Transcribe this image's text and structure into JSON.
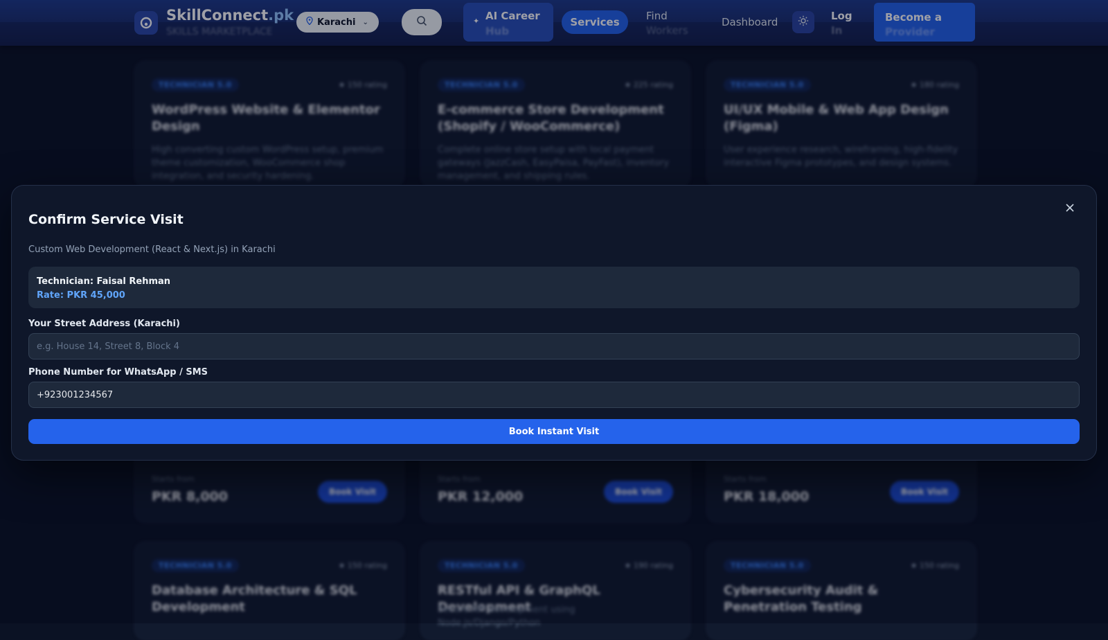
{
  "nav": {
    "brand": {
      "name": "SkillConnect",
      "tld": ".pk",
      "tagline": "SKILLS MARKETPLACE"
    },
    "city": "Karachi",
    "ai_career": {
      "line1": "AI Career",
      "line2": "Hub"
    },
    "services": "Services",
    "find_workers": {
      "line1": "Find",
      "line2": "Workers"
    },
    "dashboard": "Dashboard",
    "login": {
      "line1": "Log",
      "line2": "In"
    },
    "become_provider": {
      "line1": "Become a",
      "line2": "Provider"
    }
  },
  "cards": [
    {
      "badge": "TECHNICIAN 5.0",
      "rating": "★ 150 rating",
      "title": "WordPress Website & Elementor Design",
      "desc": "High converting custom WordPress setup, premium theme customization, WooCommerce shop integration, and security hardening."
    },
    {
      "badge": "TECHNICIAN 5.0",
      "rating": "★ 225 rating",
      "title": "E-commerce Store Development (Shopify / WooCommerce)",
      "desc": "Complete online store setup with local payment gateways (JazzCash, EasyPaisa, PayFast), inventory management, and shipping rules."
    },
    {
      "badge": "TECHNICIAN 5.0",
      "rating": "★ 180 rating",
      "title": "UI/UX Mobile & Web App Design (Figma)",
      "desc": "User experience research, wireframing, high-fidelity interactive Figma prototypes, and design systems."
    },
    {
      "slabel": "Starts from",
      "price": "PKR 8,000",
      "book": "Book Visit"
    },
    {
      "slabel": "Starts from",
      "price": "PKR 12,000",
      "book": "Book Visit"
    },
    {
      "slabel": "Starts from",
      "price": "PKR 18,000",
      "book": "Book Visit"
    },
    {
      "badge": "TECHNICIAN 5.0",
      "rating": "★ 150 rating",
      "title": "Database Architecture & SQL Development"
    },
    {
      "badge": "TECHNICIAN 5.0",
      "rating": "★ 190 rating",
      "title": "RESTful API & GraphQL Development",
      "desc": "Secure API development using Node.js/Django/Python"
    },
    {
      "badge": "TECHNICIAN 5.0",
      "rating": "★ 150 rating",
      "title": "Cybersecurity Audit & Penetration Testing"
    }
  ],
  "modal": {
    "title": "Confirm Service Visit",
    "subtitle": "Custom Web Development (React & Next.js) in Karachi",
    "technician": "Technician: Faisal Rehman",
    "rate": "Rate: PKR 45,000",
    "address_label": "Your Street Address (Karachi)",
    "address_placeholder": "e.g. House 14, Street 8, Block 4",
    "address_value": "",
    "phone_label": "Phone Number for WhatsApp / SMS",
    "phone_value": "+923001234567",
    "submit": "Book Instant Visit"
  },
  "colors": {
    "primary": "#2563eb",
    "accent": "#60a5fa",
    "surface": "#0f172a",
    "field": "#1e293b"
  },
  "icons": [
    "brand-logo-icon",
    "location-pin-icon",
    "chevron-down-icon",
    "search-icon",
    "sparkle-icon",
    "sun-icon",
    "close-icon"
  ]
}
